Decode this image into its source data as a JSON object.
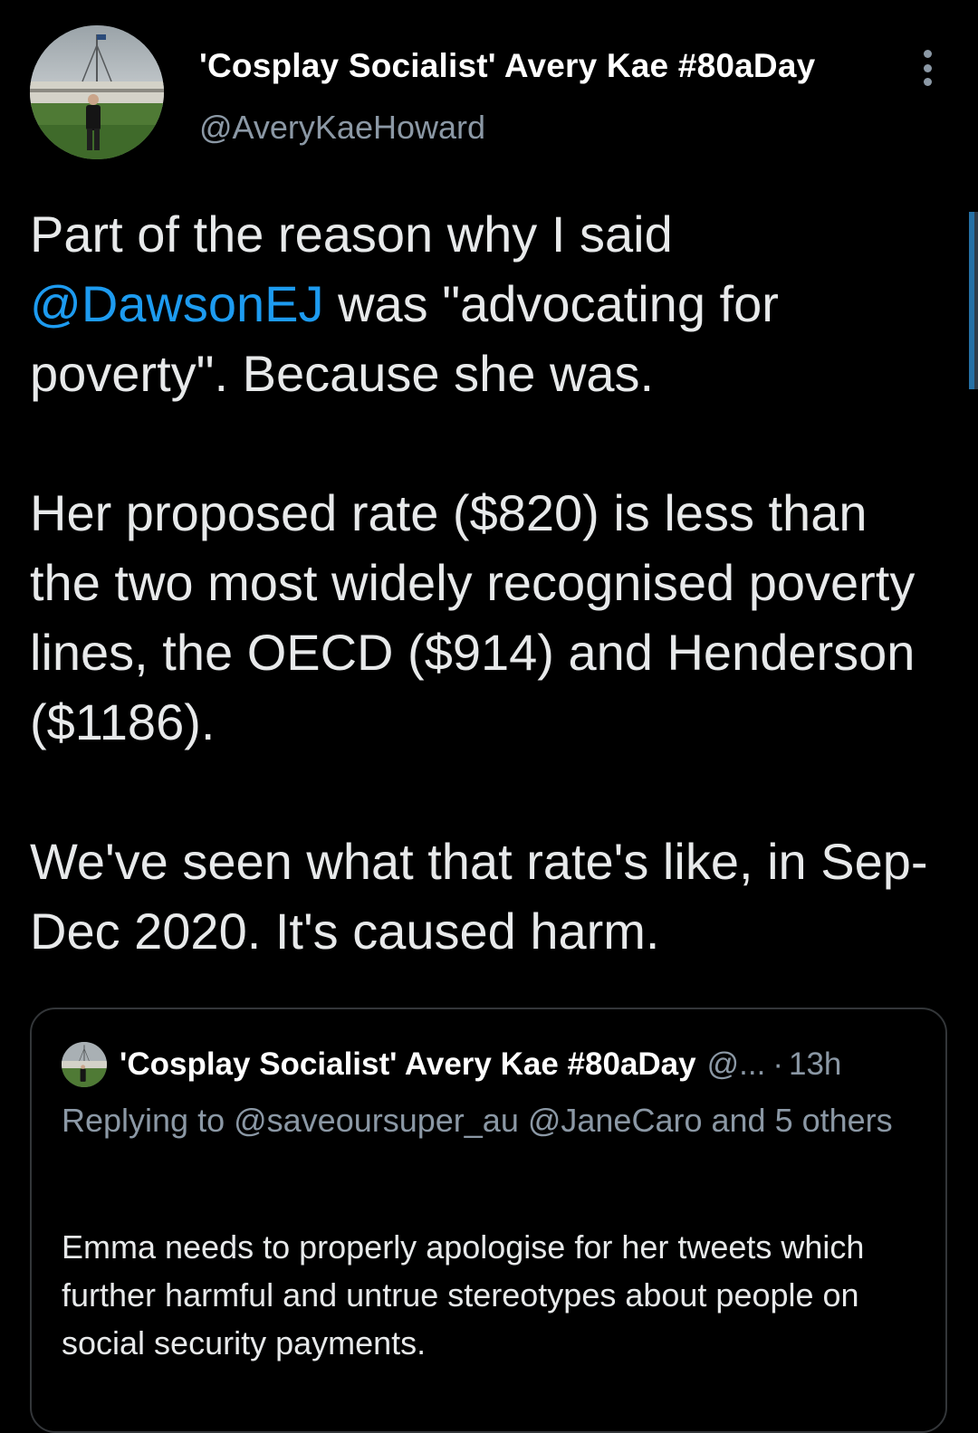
{
  "tweet": {
    "author": {
      "display_name": "'Cosplay Socialist' Avery Kae #80aDay",
      "handle": "@AveryKaeHoward",
      "avatar": "avatar-photo"
    },
    "more_icon": "more-vertical-icon",
    "text": {
      "p1_before": "Part of the reason why I said ",
      "p1_mention": "@DawsonEJ",
      "p1_after": " was \"advocating for poverty\". Because she was.",
      "p2": "Her proposed rate ($820) is less than the two most widely recognised poverty lines, the OECD ($914) and Henderson ($1186).",
      "p3": "We've seen what that rate's like, in Sep-Dec 2020. It's caused harm."
    }
  },
  "quoted_tweet": {
    "display_name": "'Cosplay Socialist' Avery Kae #80aDay",
    "handle_truncated": "@...",
    "separator": "·",
    "time": "13h",
    "reply_prefix": "Replying to ",
    "reply_to": "@saveoursuper_au @JaneCaro",
    "reply_suffix": " and 5 others",
    "text": "Emma needs to properly apologise for her tweets which further harmful and untrue stereotypes about people on social security payments."
  },
  "colors": {
    "background": "#000000",
    "text_primary": "#e7e9ea",
    "text_secondary": "#8b98a5",
    "accent": "#1d9bf0",
    "border": "#333639"
  }
}
